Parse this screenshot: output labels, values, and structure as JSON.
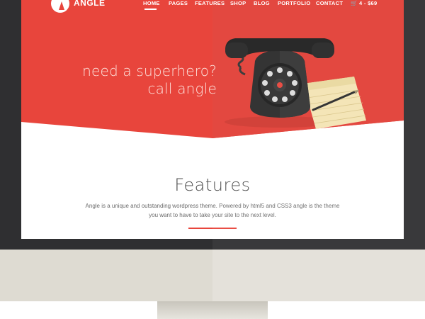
{
  "brand": {
    "name": "ANGLE"
  },
  "nav": {
    "items": [
      "HOME",
      "PAGES",
      "FEATURES",
      "SHOP",
      "BLOG",
      "PORTFOLIO",
      "CONTACT"
    ],
    "active": "HOME",
    "cart": {
      "icon": "cart-icon",
      "label": "4 - $69"
    }
  },
  "hero": {
    "line1": "need a superhero?",
    "line2": "call angle"
  },
  "features": {
    "title": "Features",
    "desc_line1": "Angle is a unique and outstanding wordpress theme. Powered by html5 and CSS3 angle is the theme",
    "desc_line2": "you want to have to take your site to the next level."
  },
  "colors": {
    "accent": "#e8453c",
    "hero_bg": "#e8453c",
    "bezel": "#2f2f31",
    "chin": "#dedbd2"
  }
}
